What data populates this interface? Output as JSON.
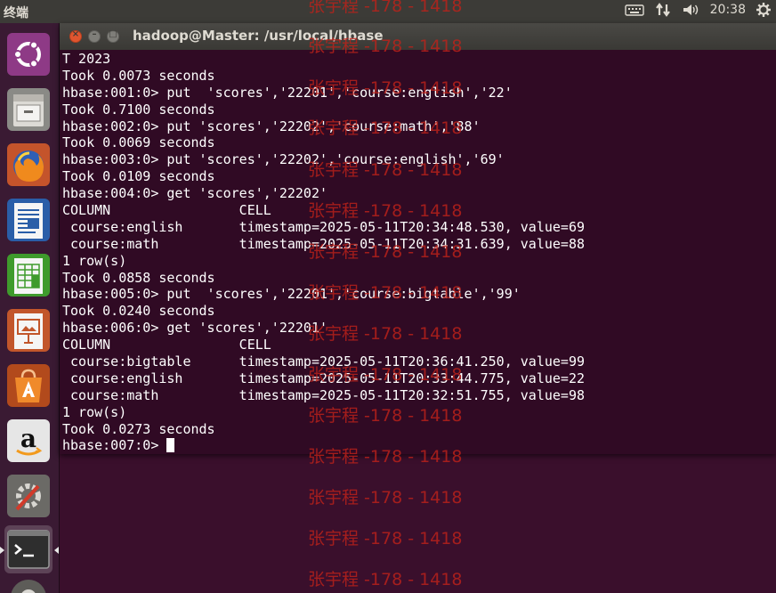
{
  "top_panel": {
    "app_name": "终端",
    "time": "20:38",
    "icons": [
      "keyboard-icon",
      "network-arrows-icon",
      "volume-icon",
      "power-gear-icon"
    ]
  },
  "launcher": {
    "items": [
      {
        "name": "ubuntu-dash-icon"
      },
      {
        "name": "files-icon"
      },
      {
        "name": "firefox-icon"
      },
      {
        "name": "writer-icon"
      },
      {
        "name": "calc-icon"
      },
      {
        "name": "impress-icon"
      },
      {
        "name": "software-center-icon"
      },
      {
        "name": "amazon-icon"
      },
      {
        "name": "system-settings-icon"
      },
      {
        "name": "terminal-icon"
      }
    ]
  },
  "window": {
    "title": "hadoop@Master: /usr/local/hbase"
  },
  "terminal": {
    "lines": [
      "T 2023",
      "Took 0.0073 seconds",
      "hbase:001:0> put  'scores','22201','course:english','22'",
      "Took 0.7100 seconds",
      "hbase:002:0> put 'scores','22202','course:math','88'",
      "Took 0.0069 seconds",
      "hbase:003:0> put 'scores','22202','course:english','69'",
      "Took 0.0109 seconds",
      "hbase:004:0> get 'scores','22202'",
      "COLUMN                CELL",
      " course:english       timestamp=2025-05-11T20:34:48.530, value=69",
      " course:math          timestamp=2025-05-11T20:34:31.639, value=88",
      "1 row(s)",
      "Took 0.0858 seconds",
      "hbase:005:0> put  'scores','22201','course:bigtable','99'",
      "Took 0.0240 seconds",
      "hbase:006:0> get 'scores','22201'",
      "COLUMN                CELL",
      " course:bigtable      timestamp=2025-05-11T20:36:41.250, value=99",
      " course:english       timestamp=2025-05-11T20:33:44.775, value=22",
      " course:math          timestamp=2025-05-11T20:32:51.755, value=98",
      "1 row(s)",
      "Took 0.0273 seconds"
    ],
    "prompt": "hbase:007:0> "
  },
  "watermark": {
    "text": "张宇程 -178 - 1418",
    "color": "#c0221a"
  }
}
